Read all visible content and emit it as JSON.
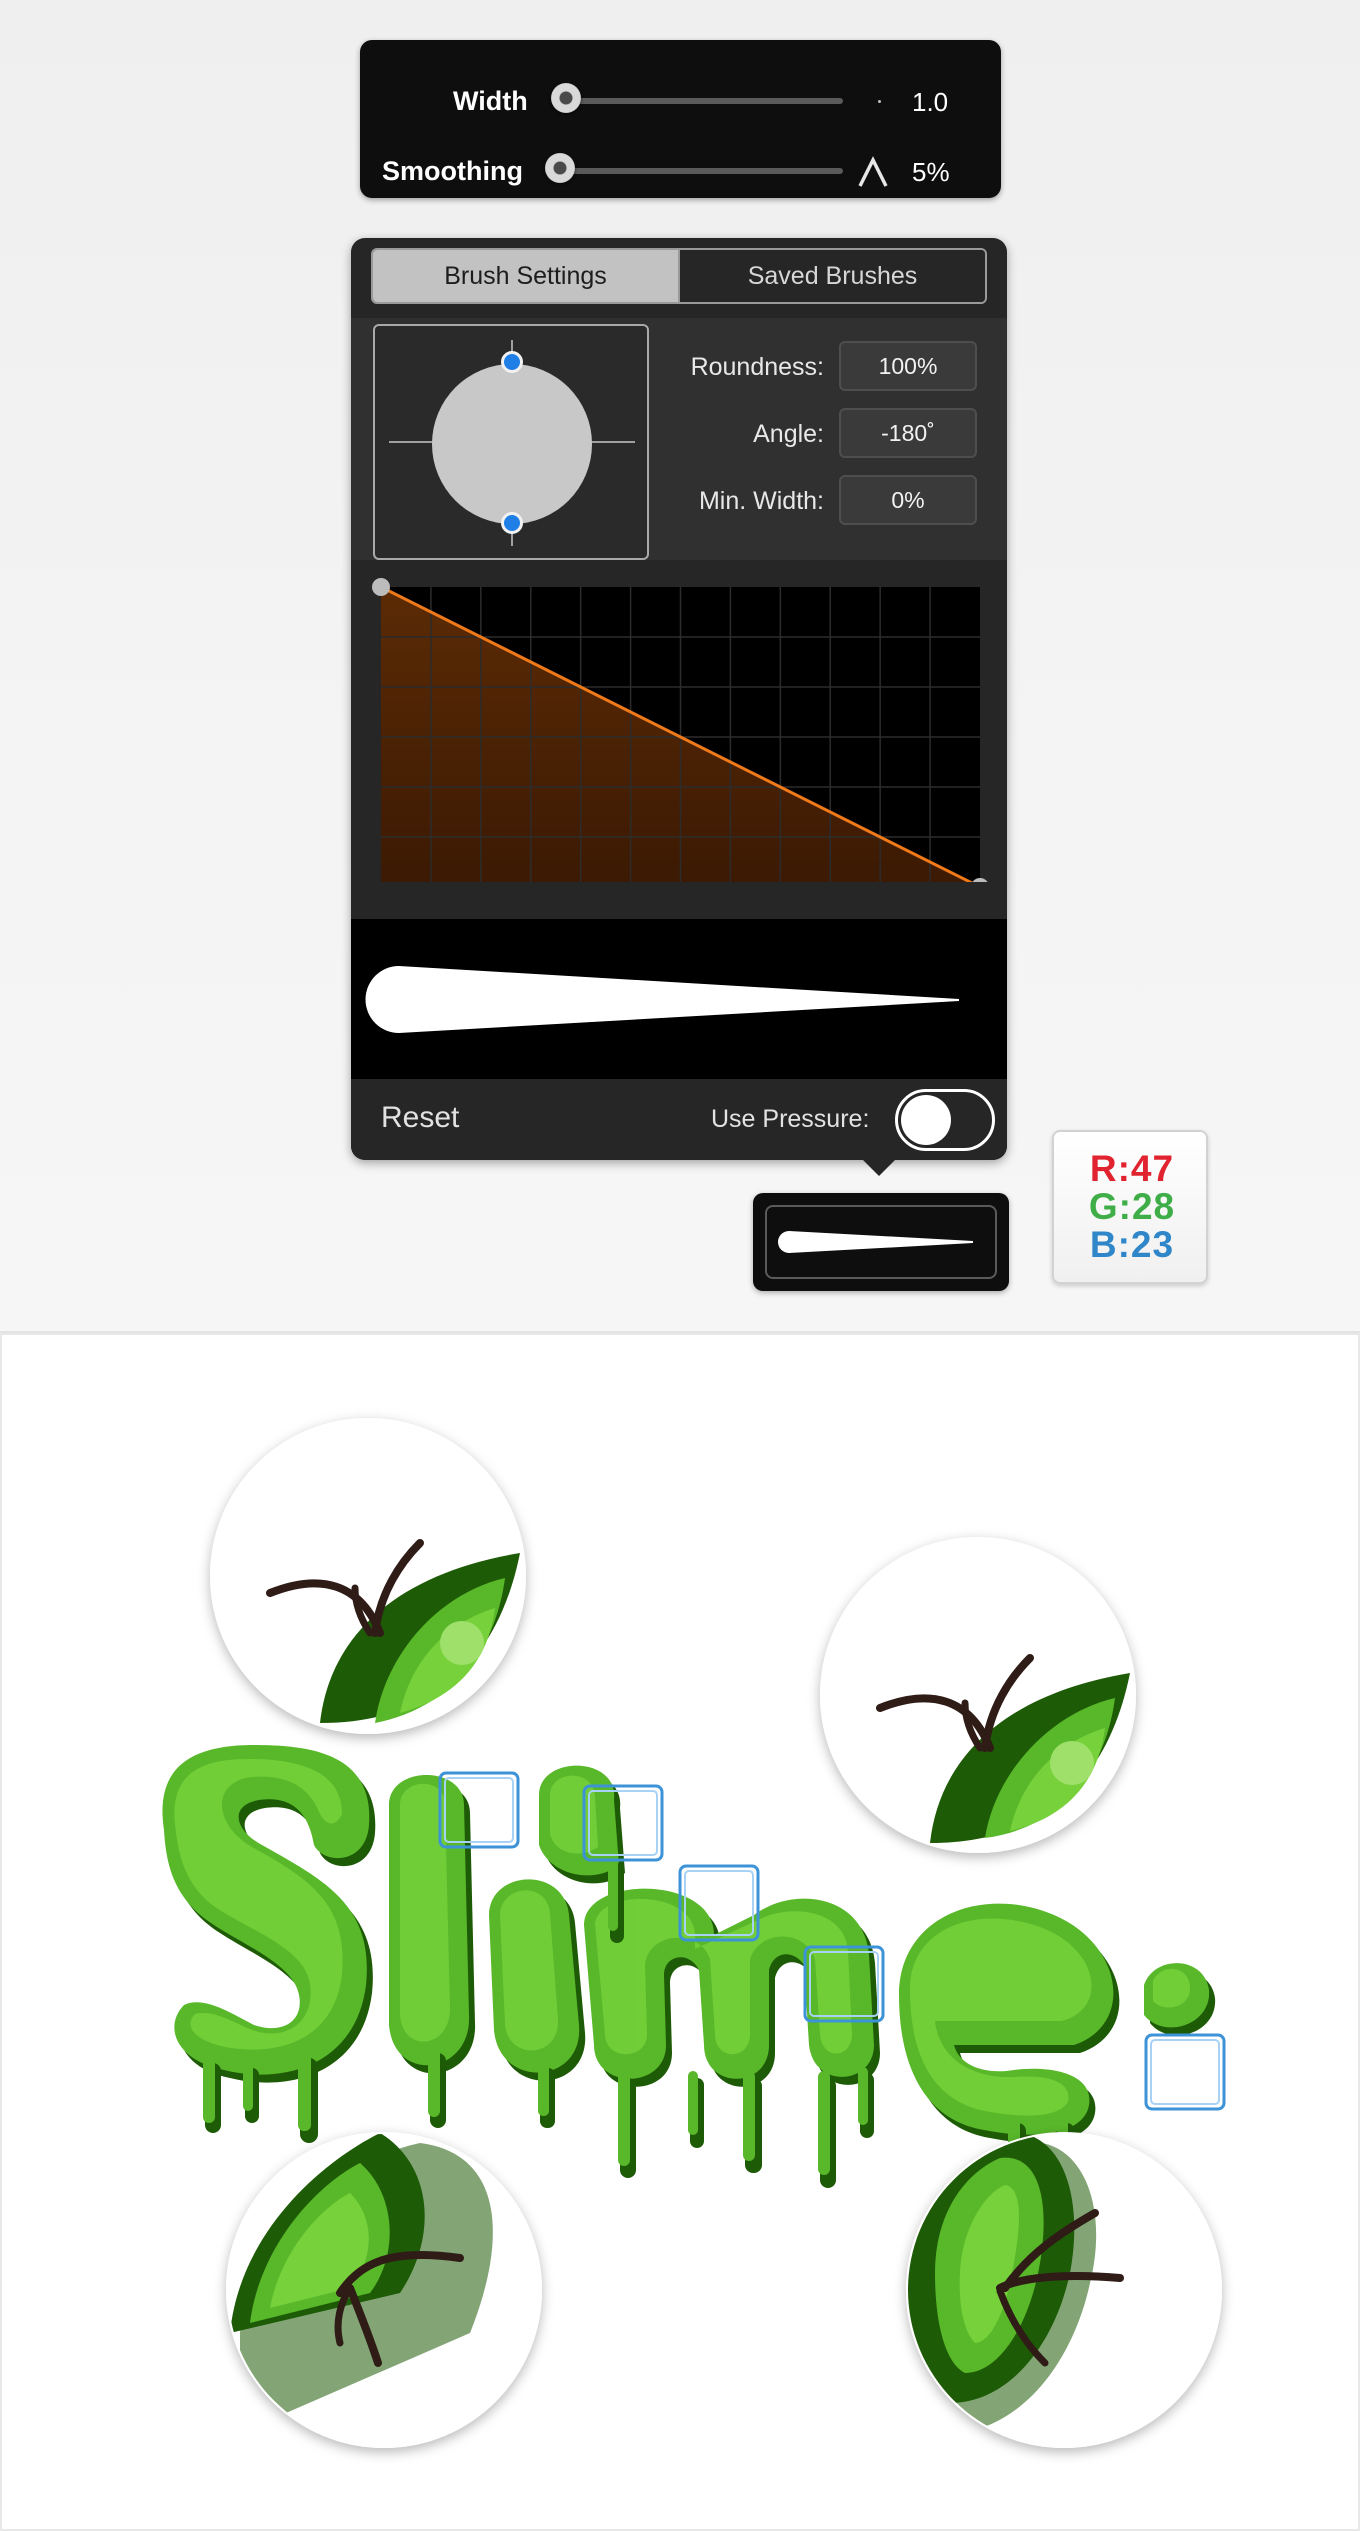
{
  "width_panel": {
    "width_label": "Width",
    "width_value": "1.0",
    "width_fraction": 0.02,
    "smoothing_label": "Smoothing",
    "smoothing_value": "5%",
    "smoothing_fraction": 0.05
  },
  "brush_panel": {
    "tabs": [
      {
        "label": "Brush Settings",
        "active": true
      },
      {
        "label": "Saved Brushes",
        "active": false
      }
    ],
    "properties": [
      {
        "label": "Roundness:",
        "value": "100%"
      },
      {
        "label": "Angle:",
        "value": "-180˚"
      },
      {
        "label": "Min. Width:",
        "value": "0%"
      }
    ],
    "pressure_curve": {
      "start": [
        0,
        1
      ],
      "end": [
        1,
        0
      ]
    },
    "reset_label": "Reset",
    "pressure_label": "Use Pressure:",
    "use_pressure": false
  },
  "rgb": {
    "r_text": "R:47",
    "g_text": "G:28",
    "b_text": "B:23",
    "r_color": "#e0232f",
    "g_color": "#3fae49",
    "b_color": "#2f86c8",
    "swatch": "#2f1c17"
  },
  "artwork": {
    "word": "Slime",
    "slime_light": "#76d13a",
    "slime_mid": "#58b82a",
    "slime_dark": "#1e5b06",
    "highlight_box_color": "#3d93d8"
  },
  "icons": {
    "smoothing": "caret-up-icon",
    "width_tick": "dot-icon"
  }
}
